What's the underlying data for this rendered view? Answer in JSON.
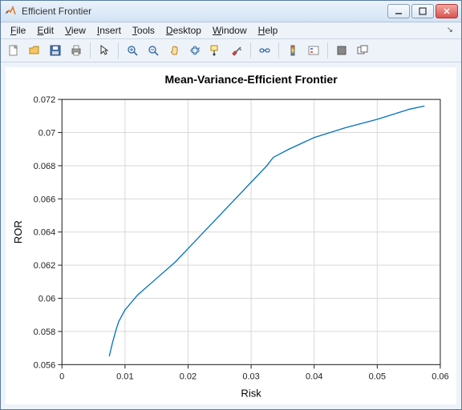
{
  "window": {
    "title": "Efficient Frontier"
  },
  "menu": {
    "file": "File",
    "edit": "Edit",
    "view": "View",
    "insert": "Insert",
    "tools": "Tools",
    "desktop": "Desktop",
    "window": "Window",
    "help": "Help"
  },
  "toolbar_tips": {
    "new": "New Figure",
    "open": "Open File",
    "save": "Save Figure",
    "print": "Print Figure",
    "pointer": "Edit Plot",
    "zoom_in": "Zoom In",
    "zoom_out": "Zoom Out",
    "pan": "Pan",
    "rotate": "Rotate 3D",
    "datacursor": "Data Cursor",
    "brush": "Brush",
    "link": "Link Plot",
    "colorbar": "Insert Colorbar",
    "legend": "Insert Legend",
    "hide": "Hide Plot Tools",
    "show": "Show Plot Tools"
  },
  "chart_data": {
    "type": "line",
    "title": "Mean-Variance-Efficient Frontier",
    "xlabel": "Risk",
    "ylabel": "ROR",
    "xlim": [
      0,
      0.06
    ],
    "ylim": [
      0.056,
      0.072
    ],
    "xticks": [
      0,
      0.01,
      0.02,
      0.03,
      0.04,
      0.05,
      0.06
    ],
    "yticks": [
      0.056,
      0.058,
      0.06,
      0.062,
      0.064,
      0.066,
      0.068,
      0.07,
      0.072
    ],
    "x": [
      0.0075,
      0.008,
      0.0085,
      0.009,
      0.01,
      0.012,
      0.015,
      0.018,
      0.02,
      0.0225,
      0.025,
      0.0275,
      0.03,
      0.0325,
      0.0335,
      0.036,
      0.04,
      0.045,
      0.05,
      0.055,
      0.0575
    ],
    "y": [
      0.0565,
      0.0573,
      0.058,
      0.0586,
      0.0593,
      0.0602,
      0.0612,
      0.0622,
      0.063,
      0.064,
      0.065,
      0.066,
      0.067,
      0.068,
      0.0685,
      0.069,
      0.0697,
      0.0703,
      0.0708,
      0.0714,
      0.0716
    ]
  }
}
